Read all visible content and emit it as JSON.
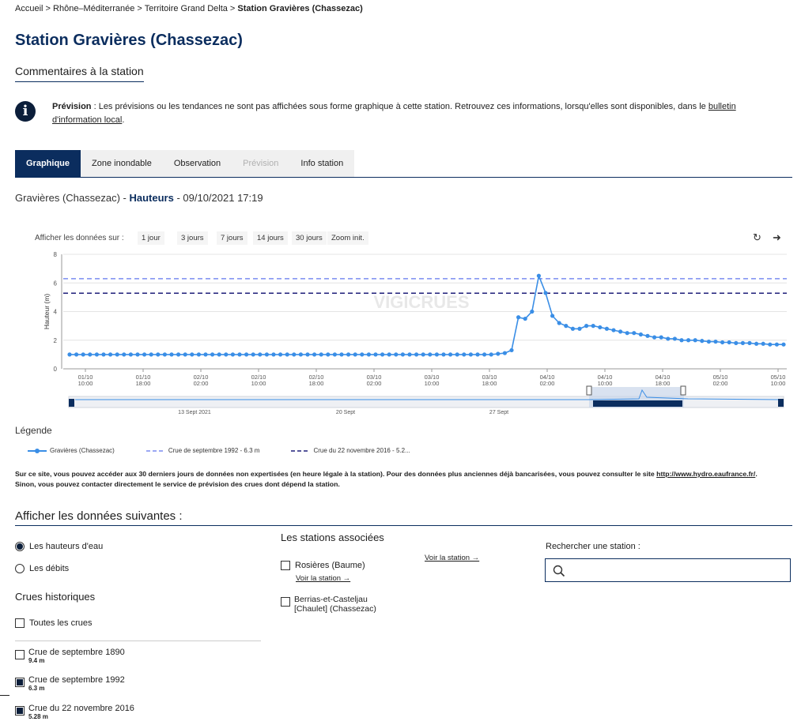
{
  "breadcrumb": {
    "home": "Accueil",
    "sep": " > ",
    "region": "Rhône–Méditerranée",
    "territory": "Territoire Grand Delta",
    "current": "Station Gravières (Chassezac)"
  },
  "page": {
    "title": "Station Gravières (Chassezac)",
    "subtitle": "Commentaires à la station"
  },
  "info": {
    "icon": "info-icon",
    "bold": "Prévision",
    "text": " : Les prévisions ou les tendances ne sont pas affichées sous forme graphique à cette station. Retrouvez ces informations, lorsqu'elles sont disponibles, dans le ",
    "link": "bulletin d'information local",
    "end": "."
  },
  "tabs": [
    "Graphique",
    "Zone inondable",
    "Observation",
    "Prévision",
    "Info station"
  ],
  "chart_header": {
    "station": "Gravières (Chassezac) - ",
    "variable": "Hauteurs",
    "datetime": " - 09/10/2021 17:19"
  },
  "range": {
    "label": "Afficher les données sur :",
    "buttons": [
      "1 jour",
      "3 jours",
      "7 jours",
      "14 jours",
      "30 jours",
      "Zoom init."
    ],
    "refresh_icon": "refresh-icon",
    "share_icon": "arrow-icon"
  },
  "chart_data": {
    "type": "line",
    "ylabel": "Hauteur (m)",
    "ylim": [
      0,
      8
    ],
    "yticks": [
      "0",
      "2",
      "4",
      "6",
      "8"
    ],
    "xticks": [
      [
        "01/10",
        "10:00"
      ],
      [
        "01/10",
        "18:00"
      ],
      [
        "02/10",
        "02:00"
      ],
      [
        "02/10",
        "10:00"
      ],
      [
        "02/10",
        "18:00"
      ],
      [
        "03/10",
        "02:00"
      ],
      [
        "03/10",
        "10:00"
      ],
      [
        "03/10",
        "18:00"
      ],
      [
        "04/10",
        "02:00"
      ],
      [
        "04/10",
        "10:00"
      ],
      [
        "04/10",
        "18:00"
      ],
      [
        "05/10",
        "02:00"
      ],
      [
        "05/10",
        "10:00"
      ]
    ],
    "watermark": "VIGICRUES",
    "series": [
      {
        "name": "Gravières (Chassezac)",
        "color": "#3a8ee6",
        "values": [
          1.0,
          1.0,
          1.0,
          1.0,
          1.0,
          1.0,
          1.0,
          1.0,
          1.0,
          1.0,
          1.0,
          1.0,
          1.0,
          1.0,
          1.0,
          1.0,
          1.0,
          1.0,
          1.0,
          1.0,
          1.0,
          1.0,
          1.0,
          1.0,
          1.0,
          1.0,
          1.0,
          1.0,
          1.0,
          1.0,
          1.0,
          1.0,
          1.0,
          1.0,
          1.0,
          1.0,
          1.0,
          1.0,
          1.0,
          1.0,
          1.0,
          1.0,
          1.0,
          1.0,
          1.0,
          1.0,
          1.0,
          1.0,
          1.0,
          1.0,
          1.0,
          1.0,
          1.0,
          1.0,
          1.0,
          1.0,
          1.0,
          1.0,
          1.0,
          1.0,
          1.0,
          1.0,
          1.0,
          1.05,
          1.1,
          1.3,
          3.6,
          3.5,
          4.0,
          6.5,
          5.3,
          3.7,
          3.2,
          3.0,
          2.8,
          2.8,
          3.0,
          3.0,
          2.9,
          2.8,
          2.7,
          2.6,
          2.5,
          2.5,
          2.4,
          2.3,
          2.2,
          2.2,
          2.1,
          2.1,
          2.0,
          2.0,
          2.0,
          1.95,
          1.9,
          1.9,
          1.85,
          1.85,
          1.8,
          1.8,
          1.8,
          1.75,
          1.75,
          1.7,
          1.7,
          1.7
        ]
      },
      {
        "name": "Crue de septembre 1992 - 6.3 m",
        "color": "#7a8cf0",
        "value": 6.3
      },
      {
        "name": "Crue du 22 novembre 2016 - 5.2...",
        "color": "#1e1e7a",
        "value": 5.28
      }
    ],
    "navigator": {
      "labels": [
        "13 Sept 2021",
        "20 Sept",
        "27 Sept"
      ]
    }
  },
  "legend": {
    "title": "Légende",
    "items": [
      "Gravières (Chassezac)",
      "Crue de septembre 1992 - 6.3 m",
      "Crue du 22 novembre 2016 - 5.2..."
    ],
    "colors": [
      "#3a8ee6",
      "#7a8cf0",
      "#1e1e7a"
    ]
  },
  "note": {
    "text1": "Sur ce site, vous pouvez accéder aux 30 derniers jours de données non expertisées (en heure légale à la station). Pour des données plus anciennes déjà bancarisées, vous pouvez consulter le site",
    "link": "http://www.hydro.eaufrance.fr/",
    "text2": ". Sinon, vous pouvez contacter directement le service de prévision des crues dont dépend la station."
  },
  "display": {
    "title": "Afficher les données suivantes :",
    "radio_heights": "Les hauteurs d'eau",
    "radio_flows": "Les débits",
    "historic_title": "Crues historiques",
    "all_crues": "Toutes les crues",
    "crues": [
      {
        "label": "Crue de septembre 1890",
        "value": "9.4 m",
        "checked": false
      },
      {
        "label": "Crue de septembre 1992",
        "value": "6.3 m",
        "checked": true
      },
      {
        "label": "Crue du 22 novembre 2016",
        "value": "5.28 m",
        "checked": true
      }
    ]
  },
  "associated": {
    "title": "Les stations associées",
    "stations": [
      {
        "name": "Rosières (Baume)",
        "link": "Voir la station →"
      },
      {
        "name": "Berrias-et-Casteljau [Chaulet] (Chassezac)",
        "link": "Voir la station →"
      }
    ]
  },
  "search": {
    "label": "Rechercher une station :",
    "icon": "search-icon"
  }
}
